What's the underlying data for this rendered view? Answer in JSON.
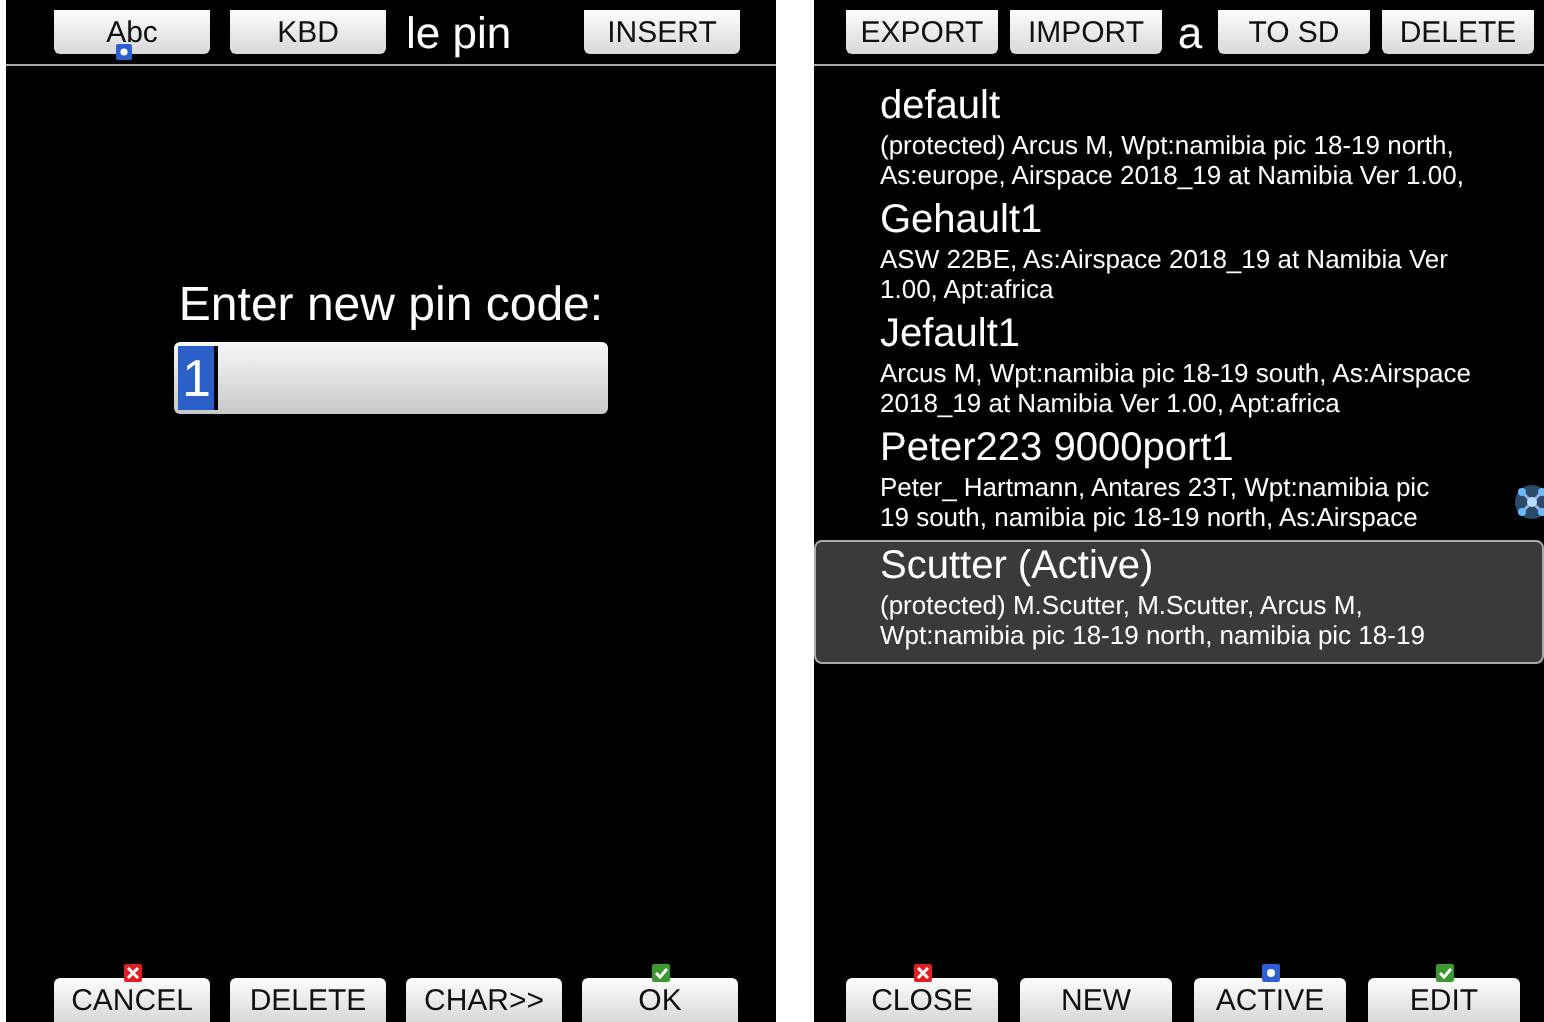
{
  "left_screen": {
    "top_bar": [
      {
        "kind": "button",
        "label": "Abc",
        "focused": true
      },
      {
        "kind": "button",
        "label": "KBD"
      },
      {
        "kind": "title",
        "label": "le pin"
      },
      {
        "kind": "button",
        "label": "INSERT"
      }
    ],
    "prompt": "Enter new pin code:",
    "pin_field": {
      "value": "1"
    },
    "bottom_bar": [
      {
        "label": "CANCEL",
        "kind": "cancel"
      },
      {
        "label": "DELETE",
        "kind": "plain"
      },
      {
        "label": "CHAR>>",
        "kind": "plain"
      },
      {
        "label": "OK",
        "kind": "ok"
      }
    ]
  },
  "right_screen": {
    "top_bar": [
      {
        "kind": "button",
        "label": "EXPORT"
      },
      {
        "kind": "button",
        "label": "IMPORT"
      },
      {
        "kind": "title",
        "label": "a"
      },
      {
        "kind": "button",
        "label": "TO SD"
      },
      {
        "kind": "button",
        "label": "DELETE"
      }
    ],
    "profiles": [
      {
        "name": "default",
        "selected": false,
        "lines": [
          "(protected) Arcus M, Wpt:namibia pic 18-19 north,",
          "As:europe, Airspace 2018_19 at Namibia Ver 1.00,"
        ]
      },
      {
        "name": "Gehault1",
        "selected": false,
        "lines": [
          "ASW 22BE, As:Airspace 2018_19 at Namibia Ver",
          "1.00, Apt:africa"
        ]
      },
      {
        "name": "Jefault1",
        "selected": false,
        "lines": [
          "Arcus M, Wpt:namibia pic 18-19 south, As:Airspace",
          "2018_19 at Namibia Ver 1.00, Apt:africa"
        ]
      },
      {
        "name": "Peter223 9000port1",
        "selected": false,
        "badge": true,
        "lines": [
          "Peter_ Hartmann, Antares 23T, Wpt:namibia pic",
          "19 south, namibia pic 18-19 north, As:Airspace"
        ]
      },
      {
        "name": "Scutter (Active)",
        "selected": true,
        "lines": [
          "(protected) M.Scutter, M.Scutter, Arcus M,",
          "Wpt:namibia pic 18-19 north, namibia pic 18-19"
        ]
      }
    ],
    "bottom_bar": [
      {
        "label": "CLOSE",
        "kind": "cancel"
      },
      {
        "label": "NEW",
        "kind": "plain"
      },
      {
        "label": "ACTIVE",
        "kind": "active"
      },
      {
        "label": "EDIT",
        "kind": "ok"
      }
    ]
  }
}
